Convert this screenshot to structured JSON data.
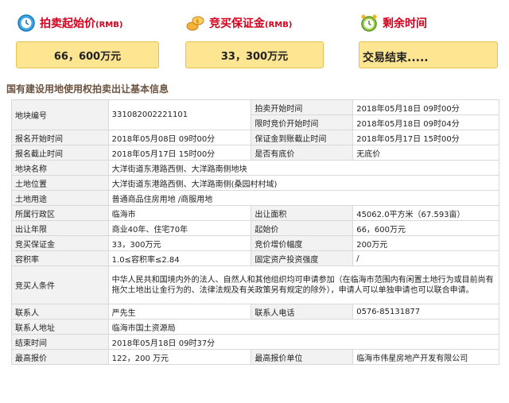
{
  "summary": {
    "start_price": {
      "label": "拍卖起始价",
      "unit": "(RMB)",
      "value": "66，600万元"
    },
    "deposit": {
      "label": "竞买保证金",
      "unit": "(RMB)",
      "value": "33，300万元"
    },
    "remaining": {
      "label": "剩余时间",
      "value": "交易结束....."
    }
  },
  "section_title": "国有建设用地使用权拍卖出让基本信息",
  "rows": [
    {
      "k1": "地块编号",
      "v1": "331082002221101",
      "k2": "拍卖开始时间",
      "v2": "2018年05月18日 09时00分"
    },
    {
      "k1": "",
      "v1": "",
      "k2": "限时竞价开始时间",
      "v2": "2018年05月18日 09时04分"
    },
    {
      "k1": "报名开始时间",
      "v1": "2018年05月08日 09时00分",
      "k2": "保证金到账截止时间",
      "v2": "2018年05月17日 15时00分"
    },
    {
      "k1": "报名截止时间",
      "v1": "2018年05月17日 15时00分",
      "k2": "是否有底价",
      "v2": "无底价"
    },
    {
      "k1": "地块名称",
      "full": "大洋街道东港路西侧、大洋路南侧地块"
    },
    {
      "k1": "土地位置",
      "full": "大洋街道东港路西侧、大洋路南侧(桑园村村域)"
    },
    {
      "k1": "土地用途",
      "full": "普通商品住房用地 /商服用地"
    },
    {
      "k1": "所属行政区",
      "v1": "临海市",
      "k2": "出让面积",
      "v2": "45062.0平方米（67.593亩）"
    },
    {
      "k1": "出让年限",
      "v1": "商业40年、住宅70年",
      "k2": "起始价",
      "v2": "66，600万元"
    },
    {
      "k1": "竞买保证金",
      "v1": "33，300万元",
      "k2": "竞价增价幅度",
      "v2": "200万元"
    },
    {
      "k1": "容积率",
      "v1": "1.0≤容积率≤2.84",
      "k2": "固定资产投资强度",
      "v2": "/"
    },
    {
      "k1": "竞买人条件",
      "full": "中华人民共和国境内外的法人、自然人和其他组织均可申请参加（在临海市范围内有闲置土地行为或目前尚有拖欠土地出让金行为的、法律法规及有关政策另有规定的除外），申请人可以单独申请也可以联合申请。"
    },
    {
      "k1": "联系人",
      "v1": "严先生",
      "k2": "联系人电话",
      "v2": "0576-85131877"
    },
    {
      "k1": "联系人地址",
      "full": "临海市国土资源局"
    },
    {
      "k1": "结束时间",
      "full": "2018年05月18日 09时37分"
    },
    {
      "k1": "最高报价",
      "v1": "122，200 万元",
      "k2": "最高报价单位",
      "v2": "临海市伟星房地产开发有限公司"
    }
  ],
  "colors": {
    "title_red": "#d4001d",
    "value_bg": "#fde592",
    "label_bg": "#f2f2f2"
  }
}
